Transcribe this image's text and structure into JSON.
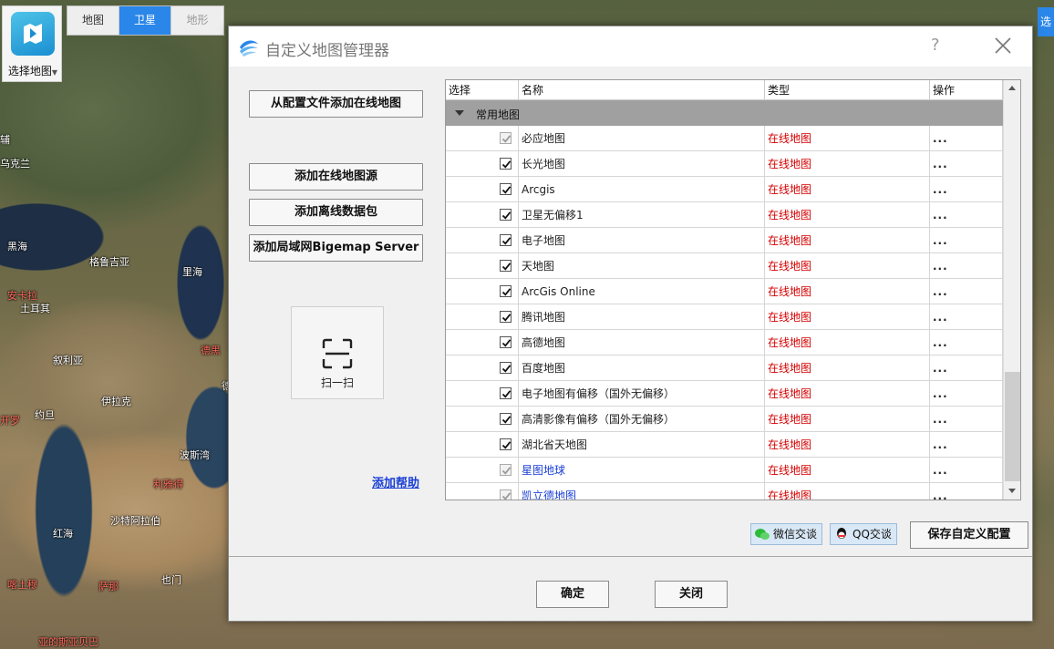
{
  "map": {
    "logo_label": "选择地图",
    "types": [
      {
        "label": "地图",
        "state": "normal"
      },
      {
        "label": "卫星",
        "state": "active"
      },
      {
        "label": "地形",
        "state": "disabled"
      }
    ],
    "right_button": "选",
    "labels": {
      "l1": "辅",
      "l2": "乌克兰",
      "l3": "黑海",
      "l4": "格鲁吉亚",
      "l5": "里海",
      "l6": "安卡拉",
      "l7": "土耳其",
      "l8": "叙利亚",
      "l9": "德黑",
      "l10": "伊拉克",
      "l11": "开罗",
      "l12": "约旦",
      "l13": "波斯湾",
      "l14": "利雅得",
      "l15": "红海",
      "l16": "沙特阿拉伯",
      "l17": "喀土穆",
      "l18": "萨那",
      "l19": "也门",
      "l20": "亚的斯亚贝巴",
      "l21": "德"
    }
  },
  "dialog": {
    "title": "自定义地图管理器",
    "help": "?",
    "left_buttons": {
      "add_from_config": "从配置文件添加在线地图",
      "add_online_source": "添加在线地图源",
      "add_offline_pack": "添加离线数据包",
      "add_lan_server": "添加局域网Bigemap Server"
    },
    "scan_label": "扫一扫",
    "help_link": "添加帮助",
    "table": {
      "headers": [
        "选择",
        "名称",
        "类型",
        "操作"
      ],
      "group": "常用地图",
      "rows": [
        {
          "checked_style": "grey",
          "name": "必应地图",
          "type": "在线地图",
          "ops": "...",
          "blue": false
        },
        {
          "checked_style": "normal",
          "name": "长光地图",
          "type": "在线地图",
          "ops": "...",
          "blue": false
        },
        {
          "checked_style": "normal",
          "name": "Arcgis",
          "type": "在线地图",
          "ops": "...",
          "blue": false
        },
        {
          "checked_style": "normal",
          "name": "卫星无偏移1",
          "type": "在线地图",
          "ops": "...",
          "blue": false
        },
        {
          "checked_style": "normal",
          "name": "电子地图",
          "type": "在线地图",
          "ops": "...",
          "blue": false
        },
        {
          "checked_style": "normal",
          "name": "天地图",
          "type": "在线地图",
          "ops": "...",
          "blue": false
        },
        {
          "checked_style": "normal",
          "name": "ArcGis Online",
          "type": "在线地图",
          "ops": "...",
          "blue": false
        },
        {
          "checked_style": "normal",
          "name": "腾讯地图",
          "type": "在线地图",
          "ops": "...",
          "blue": false
        },
        {
          "checked_style": "normal",
          "name": "高德地图",
          "type": "在线地图",
          "ops": "...",
          "blue": false
        },
        {
          "checked_style": "normal",
          "name": "百度地图",
          "type": "在线地图",
          "ops": "...",
          "blue": false
        },
        {
          "checked_style": "normal",
          "name": "电子地图有偏移（国外无偏移）",
          "type": "在线地图",
          "ops": "...",
          "blue": false
        },
        {
          "checked_style": "normal",
          "name": "高清影像有偏移（国外无偏移）",
          "type": "在线地图",
          "ops": "...",
          "blue": false
        },
        {
          "checked_style": "normal",
          "name": "湖北省天地图",
          "type": "在线地图",
          "ops": "...",
          "blue": false
        },
        {
          "checked_style": "grey",
          "name": "星图地球",
          "type": "在线地图",
          "ops": "...",
          "blue": true
        },
        {
          "checked_style": "grey",
          "name": "凯立德地图",
          "type": "在线地图",
          "ops": "...",
          "blue": true
        }
      ]
    },
    "wechat_label": "微信交谈",
    "qq_label": "QQ交谈",
    "save_label": "保存自定义配置",
    "ok_label": "确定",
    "close_label": "关闭"
  }
}
